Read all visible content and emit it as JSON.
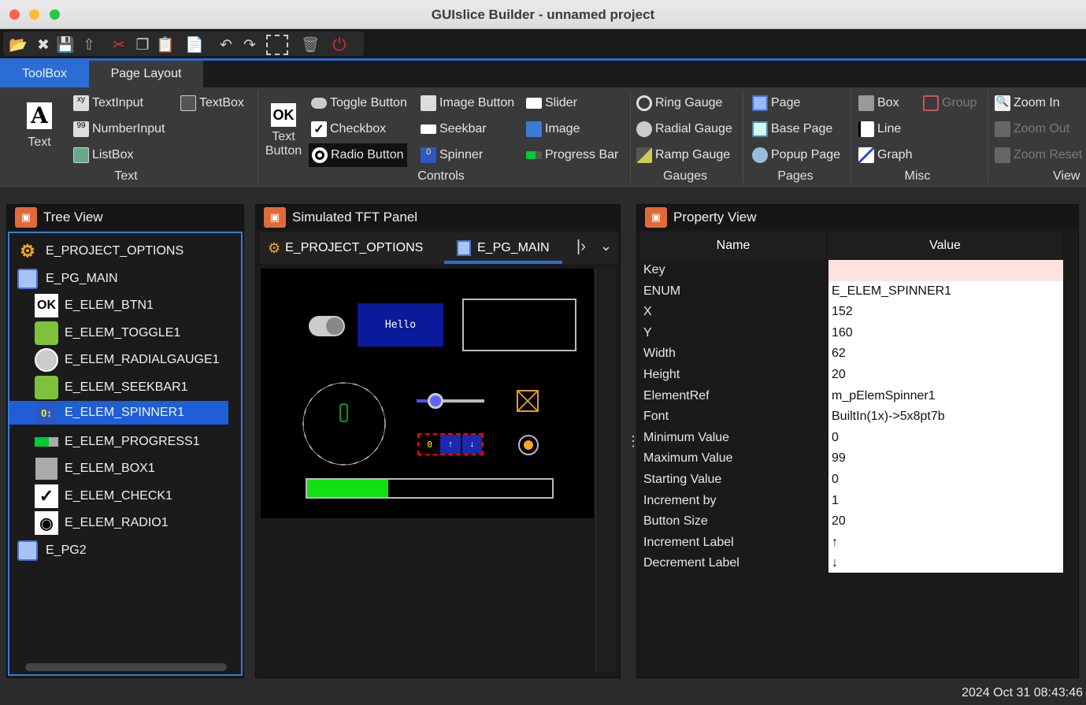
{
  "window": {
    "title": "GUIslice Builder - unnamed project"
  },
  "tabs": [
    {
      "label": "ToolBox"
    },
    {
      "label": "Page Layout"
    }
  ],
  "ribbon": {
    "text_big": "Text",
    "text_button_line1": "Text",
    "text_button_line2": "Button",
    "items": {
      "textinput": "TextInput",
      "textbox": "TextBox",
      "numberinput": "NumberInput",
      "listbox": "ListBox",
      "toggle": "Toggle Button",
      "image_button": "Image Button",
      "slider": "Slider",
      "checkbox": "Checkbox",
      "seekbar": "Seekbar",
      "image": "Image",
      "radio": "Radio Button",
      "spinner": "Spinner",
      "progress": "Progress Bar",
      "ring": "Ring Gauge",
      "radial": "Radial Gauge",
      "ramp": "Ramp Gauge",
      "page": "Page",
      "base_page": "Base Page",
      "popup_page": "Popup Page",
      "box": "Box",
      "group": "Group",
      "line": "Line",
      "graph": "Graph",
      "zoom_in": "Zoom In",
      "zoom_out": "Zoom Out",
      "zoom_reset": "Zoom Reset"
    },
    "groups": {
      "text": "Text",
      "controls": "Controls",
      "gauges": "Gauges",
      "pages": "Pages",
      "misc": "Misc",
      "view": "View"
    }
  },
  "tree": {
    "title": "Tree View",
    "nodes": [
      "E_PROJECT_OPTIONS",
      "E_PG_MAIN",
      "E_ELEM_BTN1",
      "E_ELEM_TOGGLE1",
      "E_ELEM_RADIALGAUGE1",
      "E_ELEM_SEEKBAR1",
      "E_ELEM_SPINNER1",
      "E_ELEM_PROGRESS1",
      "E_ELEM_BOX1",
      "E_ELEM_CHECK1",
      "E_ELEM_RADIO1",
      "E_PG2"
    ]
  },
  "tft": {
    "title": "Simulated TFT Panel",
    "tab1": "E_PROJECT_OPTIONS",
    "tab2": "E_PG_MAIN",
    "btn_text": "Hello",
    "spinner_value": "0",
    "progress": 0.33
  },
  "props": {
    "title": "Property View",
    "col_name": "Name",
    "col_value": "Value",
    "rows": [
      {
        "name": "Key",
        "value": ""
      },
      {
        "name": "ENUM",
        "value": "E_ELEM_SPINNER1"
      },
      {
        "name": "X",
        "value": "152"
      },
      {
        "name": "Y",
        "value": "160"
      },
      {
        "name": "Width",
        "value": "62"
      },
      {
        "name": "Height",
        "value": "20"
      },
      {
        "name": "ElementRef",
        "value": "m_pElemSpinner1"
      },
      {
        "name": "Font",
        "value": "BuiltIn(1x)->5x8pt7b"
      },
      {
        "name": "Minimum Value",
        "value": "0"
      },
      {
        "name": "Maximum Value",
        "value": "99"
      },
      {
        "name": "Starting Value",
        "value": "0"
      },
      {
        "name": "Increment by",
        "value": "1"
      },
      {
        "name": "Button Size",
        "value": "20"
      },
      {
        "name": "Increment Label",
        "value": "↑"
      },
      {
        "name": "Decrement Label",
        "value": "↓"
      }
    ]
  },
  "status": {
    "datetime": "2024 Oct 31 08:43:46"
  }
}
